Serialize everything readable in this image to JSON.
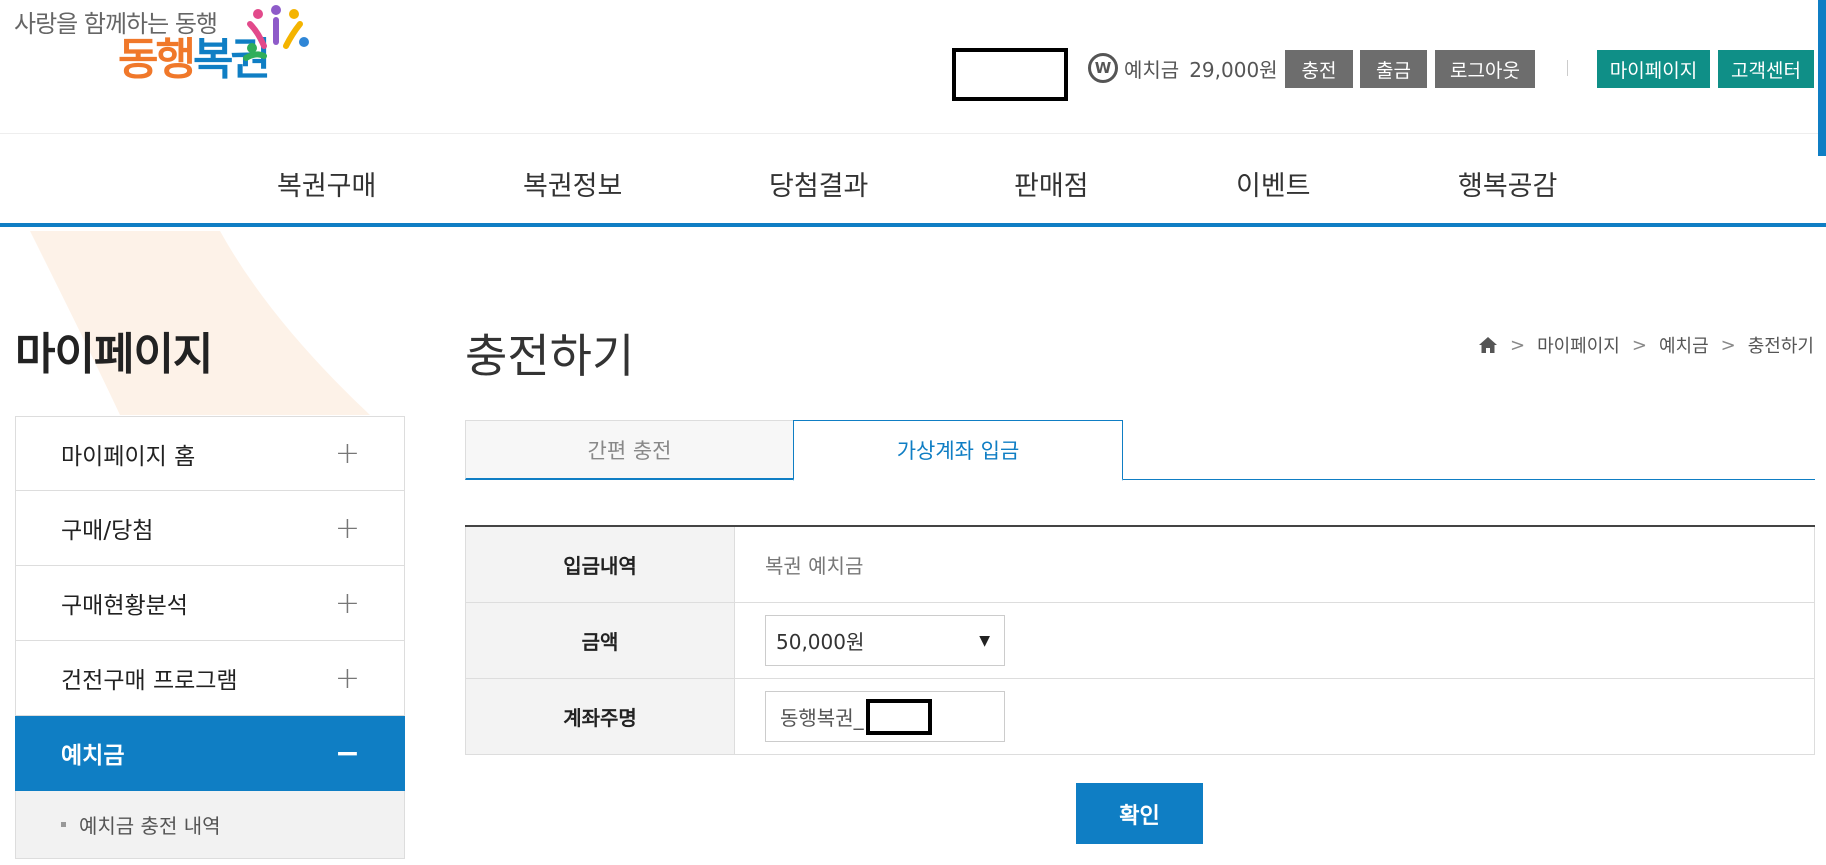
{
  "header": {
    "logo_tagline": "사랑을 함께하는 동행",
    "logo_part1": "동행",
    "logo_part2": "복권",
    "deposit_icon_letter": "W",
    "deposit_label": "예치금",
    "deposit_amount": "29,000원",
    "buttons": {
      "charge": "충전",
      "withdraw": "출금",
      "logout": "로그아웃",
      "mypage": "마이페이지",
      "customer_center": "고객센터"
    }
  },
  "gnb": {
    "items": [
      "복권구매",
      "복권정보",
      "당첨결과",
      "판매점",
      "이벤트",
      "행복공감"
    ]
  },
  "sidebar": {
    "title": "마이페이지",
    "items": [
      {
        "label": "마이페이지 홈",
        "toggle": "+"
      },
      {
        "label": "구매/당첨",
        "toggle": "+"
      },
      {
        "label": "구매현황분석",
        "toggle": "+"
      },
      {
        "label": "건전구매 프로그램",
        "toggle": "+"
      },
      {
        "label": "예치금",
        "toggle": "−"
      }
    ],
    "sub_items": [
      "예치금 충전 내역"
    ]
  },
  "content": {
    "title": "충전하기",
    "breadcrumb": [
      "마이페이지",
      "예치금",
      "충전하기"
    ],
    "tabs": [
      "간편 충전",
      "가상계좌 입금"
    ],
    "form": {
      "rows": [
        {
          "label": "입금내역",
          "value": "복권 예치금"
        },
        {
          "label": "금액",
          "value": "50,000원"
        },
        {
          "label": "계좌주명",
          "value": "동행복권_"
        }
      ]
    },
    "confirm_label": "확인"
  },
  "colors": {
    "primary": "#0f7ec4",
    "green": "#0f8f87",
    "gray_button": "#6d6d6d",
    "logo_orange": "#f0782a"
  }
}
